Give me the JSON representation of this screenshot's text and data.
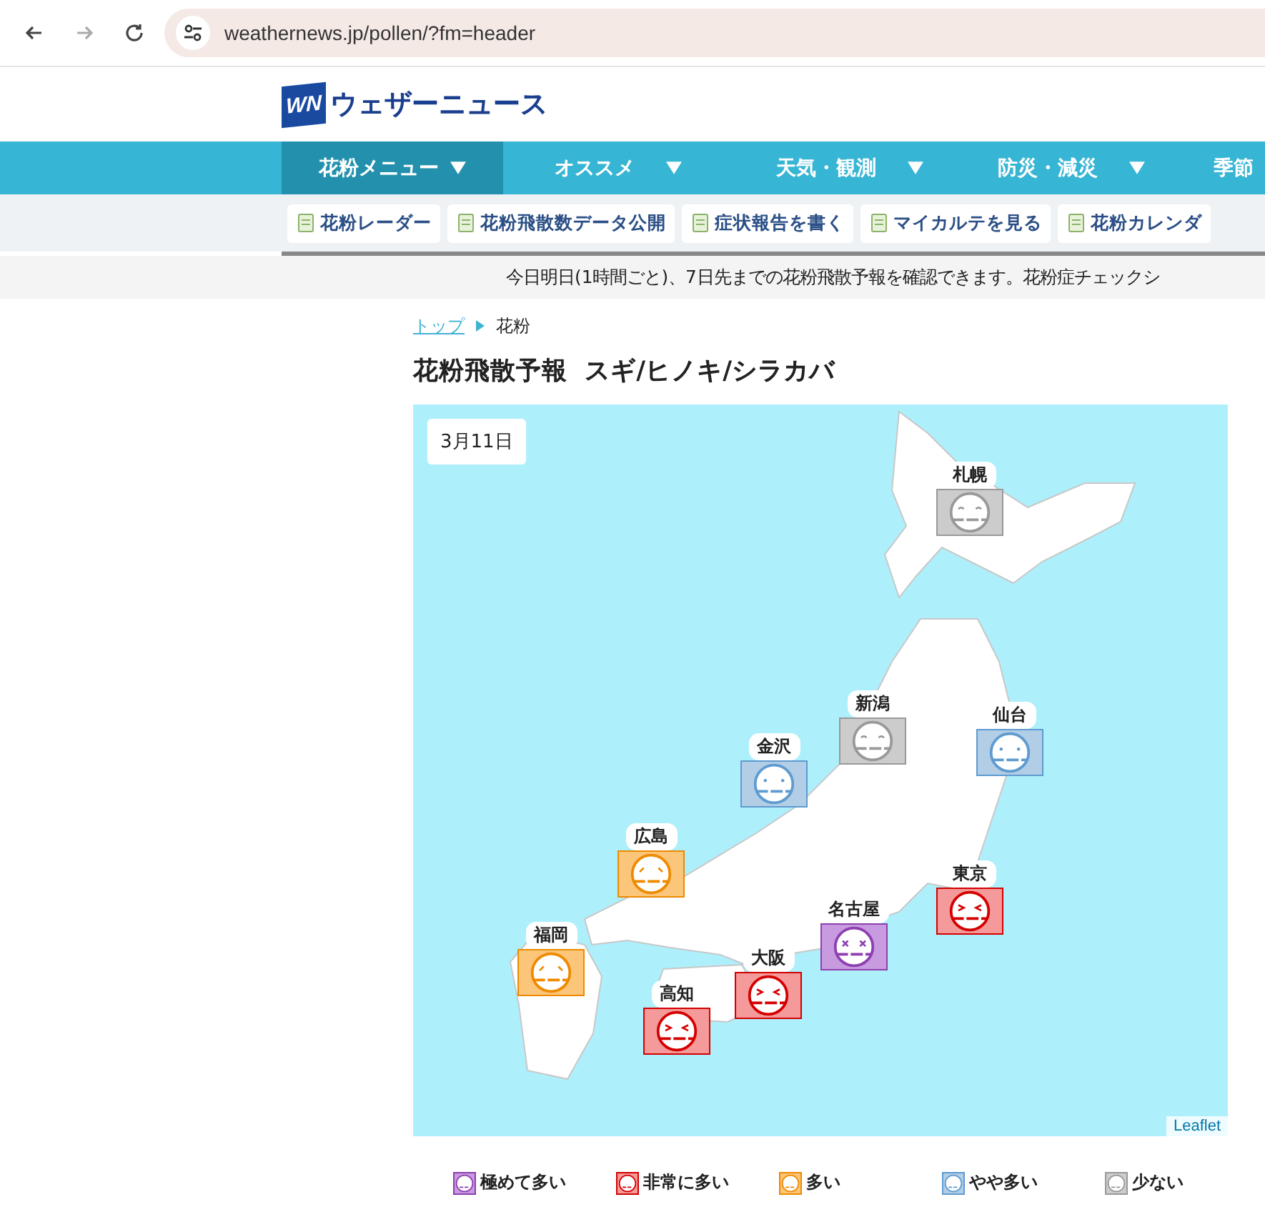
{
  "browser": {
    "url": "weathernews.jp/pollen/?fm=header"
  },
  "header": {
    "logo_mark": "WN",
    "logo_text": "ウェザーニュース"
  },
  "nav": [
    {
      "label": "花粉メニュー",
      "selected": true
    },
    {
      "label": "オススメ",
      "selected": false
    },
    {
      "label": "天気・観測",
      "selected": false
    },
    {
      "label": "防災・減災",
      "selected": false
    },
    {
      "label": "季節",
      "selected": false
    }
  ],
  "subnav": [
    "花粉レーダー",
    "花粉飛散数データ公開",
    "症状報告を書く",
    "マイカルテを見る",
    "花粉カレンダ"
  ],
  "description": "今日明日(1時間ごと)、7日先までの花粉飛散予報を確認できます。花粉症チェックシ",
  "breadcrumb": [
    "トップ",
    "花粉"
  ],
  "heading": "花粉飛散予報  スギ/ヒノキ/シラカバ",
  "map": {
    "date": "3月11日",
    "attribution": "Leaflet",
    "markers": [
      {
        "city": "札幌",
        "kind": "low"
      },
      {
        "city": "新潟",
        "kind": "low"
      },
      {
        "city": "仙台",
        "kind": "moderate"
      },
      {
        "city": "金沢",
        "kind": "moderate"
      },
      {
        "city": "広島",
        "kind": "high"
      },
      {
        "city": "東京",
        "kind": "very_high"
      },
      {
        "city": "名古屋",
        "kind": "extreme"
      },
      {
        "city": "福岡",
        "kind": "high"
      },
      {
        "city": "大阪",
        "kind": "very_high"
      },
      {
        "city": "高知",
        "kind": "very_high"
      }
    ]
  },
  "legend": [
    {
      "label": "極めて多い",
      "kind": "extreme"
    },
    {
      "label": "非常に多い",
      "kind": "very_high"
    },
    {
      "label": "多い",
      "kind": "high"
    },
    {
      "label": "やや多い",
      "kind": "moderate"
    },
    {
      "label": "少ない",
      "kind": "low"
    }
  ]
}
